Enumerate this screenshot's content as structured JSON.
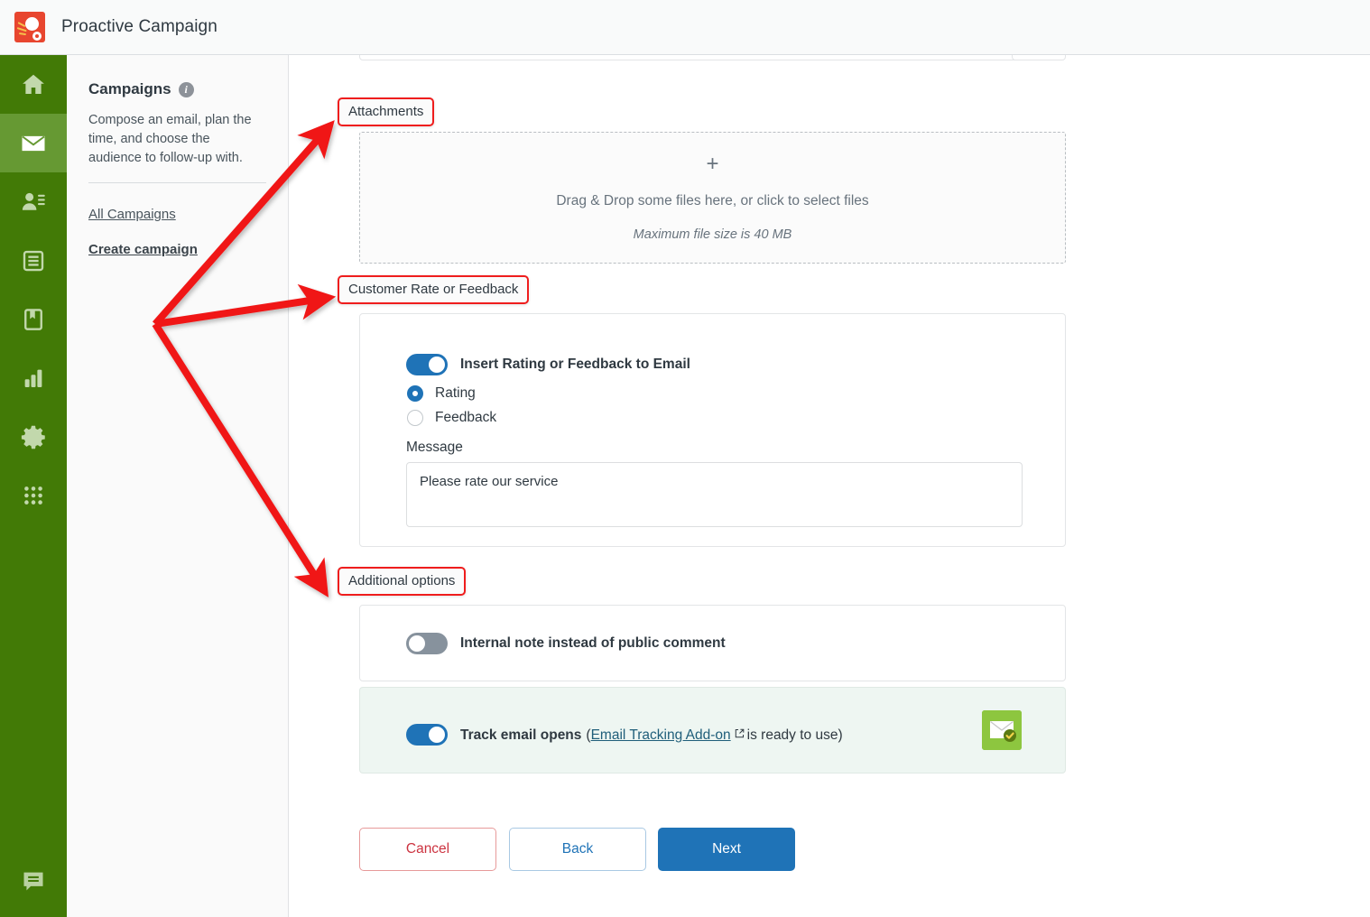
{
  "app": {
    "title": "Proactive Campaign",
    "logo_icon": "comet-logo-icon",
    "logo_color": "#e8462f"
  },
  "rail": {
    "background": "#427a06",
    "active_background": "#669933",
    "items": [
      {
        "icon": "home-icon",
        "name": "home",
        "active": false
      },
      {
        "icon": "envelope-icon",
        "name": "messaging",
        "active": true
      },
      {
        "icon": "contacts-icon",
        "name": "contacts",
        "active": false
      },
      {
        "icon": "database-icon",
        "name": "records",
        "active": false
      },
      {
        "icon": "book-icon",
        "name": "knowledge",
        "active": false
      },
      {
        "icon": "bar-chart-icon",
        "name": "reports",
        "active": false
      },
      {
        "icon": "gear-icon",
        "name": "settings",
        "active": false
      },
      {
        "icon": "grid-apps-icon",
        "name": "apps",
        "active": false
      }
    ],
    "bottom_item": {
      "icon": "chat-bubble-icon",
      "name": "chat"
    }
  },
  "sidebar": {
    "title": "Campaigns",
    "info_glyph": "i",
    "description": "Compose an email, plan the time, and choose the audience to follow-up with.",
    "links": [
      {
        "label": "All Campaigns",
        "bold": false
      },
      {
        "label": "Create campaign",
        "bold": true
      }
    ]
  },
  "sections": {
    "attachments": {
      "label": "Attachments",
      "plus_glyph": "+",
      "drop_text": "Drag & Drop some files here, or click to select files",
      "max_size_text": "Maximum file size is 40 MB"
    },
    "customer_rate": {
      "label": "Customer Rate or Feedback",
      "toggle_label": "Insert Rating or Feedback to Email",
      "toggle_state": "on",
      "options": [
        {
          "label": "Rating",
          "checked": true
        },
        {
          "label": "Feedback",
          "checked": false
        }
      ],
      "message_label": "Message",
      "message_value": "Please rate our service",
      "message_placeholder": "Message"
    },
    "additional_options": {
      "label": "Additional options",
      "internal_note": {
        "label": "Internal note instead of public comment",
        "toggle_state": "off"
      },
      "track_email": {
        "label_before": "Track email opens",
        "paren_open": "(",
        "link_label": "Email Tracking Add-on",
        "link_icon": "external-link-icon",
        "label_after": "is ready to use)",
        "toggle_state": "on",
        "badge_icon": "envelope-check-icon"
      }
    }
  },
  "footer": {
    "cancel_label": "Cancel",
    "back_label": "Back",
    "next_label": "Next"
  },
  "annotations": {
    "highlight_color": "#ef1d1d",
    "arrow_count": 3,
    "arrow_origin": "common point left of content",
    "targets": [
      "Attachments",
      "Customer Rate or Feedback",
      "Additional options"
    ]
  },
  "colors": {
    "accent_blue": "#1f73b7",
    "rail_green": "#427a06",
    "rail_active_green": "#669933",
    "danger_red": "#cc3340",
    "tinted_card": "#eef6f2",
    "addon_green": "#8dc63f"
  }
}
